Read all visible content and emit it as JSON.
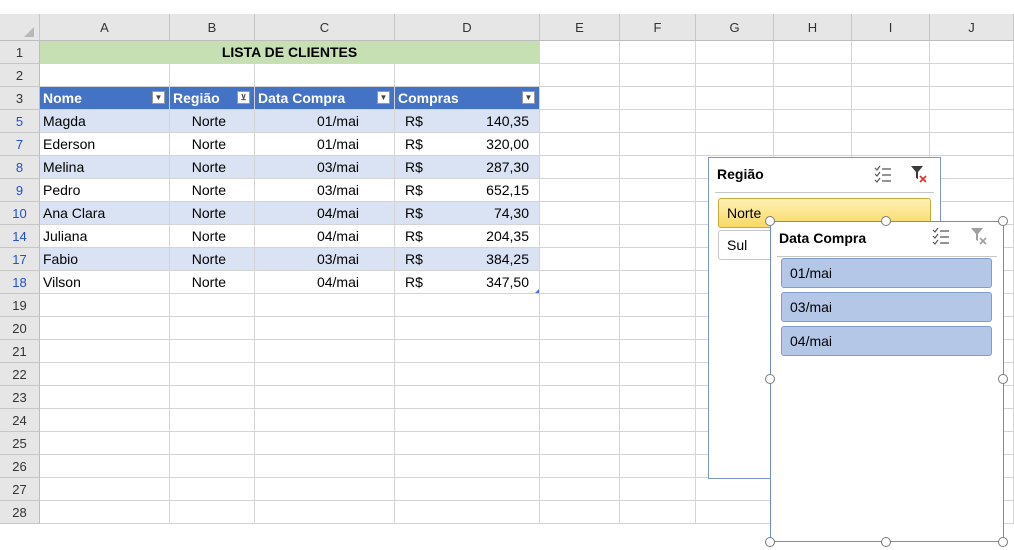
{
  "columns": [
    "A",
    "B",
    "C",
    "D",
    "E",
    "F",
    "G",
    "H",
    "I",
    "J"
  ],
  "row_numbers": [
    "1",
    "2",
    "3",
    "5",
    "7",
    "8",
    "9",
    "10",
    "14",
    "17",
    "18",
    "19",
    "20",
    "21",
    "22",
    "23",
    "24",
    "25",
    "26",
    "27",
    "28"
  ],
  "title": "LISTA DE CLIENTES",
  "table": {
    "headers": [
      "Nome",
      "Região",
      "Data Compra",
      "Compras"
    ],
    "rows": [
      {
        "nome": "Magda",
        "regiao": "Norte",
        "data": "01/mai",
        "moeda": "R$",
        "valor": "140,35"
      },
      {
        "nome": "Ederson",
        "regiao": "Norte",
        "data": "01/mai",
        "moeda": "R$",
        "valor": "320,00"
      },
      {
        "nome": "Melina",
        "regiao": "Norte",
        "data": "03/mai",
        "moeda": "R$",
        "valor": "287,30"
      },
      {
        "nome": "Pedro",
        "regiao": "Norte",
        "data": "03/mai",
        "moeda": "R$",
        "valor": "652,15"
      },
      {
        "nome": "Ana Clara",
        "regiao": "Norte",
        "data": "04/mai",
        "moeda": "R$",
        "valor": "74,30"
      },
      {
        "nome": "Juliana",
        "regiao": "Norte",
        "data": "04/mai",
        "moeda": "R$",
        "valor": "204,35"
      },
      {
        "nome": "Fabio",
        "regiao": "Norte",
        "data": "03/mai",
        "moeda": "R$",
        "valor": "384,25"
      },
      {
        "nome": "Vilson",
        "regiao": "Norte",
        "data": "04/mai",
        "moeda": "R$",
        "valor": "347,50"
      }
    ]
  },
  "slicer_regiao": {
    "title": "Região",
    "items": [
      "Norte",
      "Sul"
    ]
  },
  "slicer_data": {
    "title": "Data Compra",
    "items": [
      "01/mai",
      "03/mai",
      "04/mai"
    ]
  },
  "colors": {
    "header_blue": "#4472c4",
    "band": "#dae3f3",
    "title_green": "#c6e0b4",
    "slicer_selected_yellow": "#fce37a",
    "slicer_selected_blue": "#b4c7e7"
  }
}
